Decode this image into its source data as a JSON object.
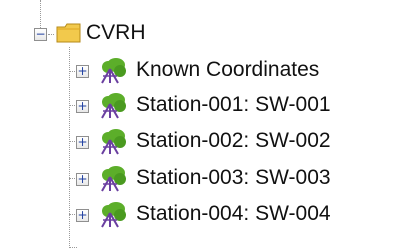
{
  "tree": {
    "root": {
      "label": "CVRH",
      "expanded": true,
      "expander_symbol": "−",
      "icon": "folder-icon",
      "icon_color": "#f2c94c"
    },
    "children": [
      {
        "label": "Known Coordinates",
        "expander_symbol": "+",
        "icon": "survey-tripod-icon"
      },
      {
        "label": "Station-001: SW-001",
        "expander_symbol": "+",
        "icon": "survey-tripod-icon"
      },
      {
        "label": "Station-002: SW-002",
        "expander_symbol": "+",
        "icon": "survey-tripod-icon"
      },
      {
        "label": "Station-003: SW-003",
        "expander_symbol": "+",
        "icon": "survey-tripod-icon"
      },
      {
        "label": "Station-004: SW-004",
        "expander_symbol": "+",
        "icon": "survey-tripod-icon"
      }
    ],
    "colors": {
      "tripod_green": "#5cae2a",
      "tripod_purple": "#6a3fa0",
      "connector_line": "#9a9a9a"
    }
  }
}
